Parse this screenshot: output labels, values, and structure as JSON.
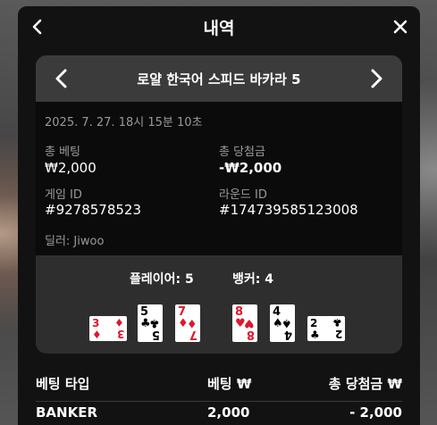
{
  "modal": {
    "title": "내역"
  },
  "game": {
    "title": "로얄 한국어 스피드 바카라 5"
  },
  "details": {
    "timestamp": "2025. 7. 27. 18시 15분 10초",
    "total_bet_label": "총 베팅",
    "total_bet_value": "₩2,000",
    "total_win_label": "총 당첨금",
    "total_win_value": "-₩2,000",
    "game_id_label": "게임 ID",
    "game_id_value": "#9278578523",
    "round_id_label": "라운드 ID",
    "round_id_value": "#174739585123008",
    "dealer": "딜러: Jiwoo"
  },
  "results": {
    "player_label": "플레이어: 5",
    "banker_label": "뱅커: 4",
    "player_cards": [
      {
        "rank": "3",
        "suit": "♦",
        "color": "#e0162b",
        "sideways": true
      },
      {
        "rank": "5",
        "suit": "♣",
        "color": "#000000",
        "sideways": false
      },
      {
        "rank": "7",
        "suit": "♦",
        "color": "#e0162b",
        "sideways": false
      }
    ],
    "banker_cards": [
      {
        "rank": "8",
        "suit": "♥",
        "color": "#e0162b",
        "sideways": false
      },
      {
        "rank": "4",
        "suit": "♠",
        "color": "#000000",
        "sideways": false
      },
      {
        "rank": "2",
        "suit": "♣",
        "color": "#000000",
        "sideways": true
      }
    ]
  },
  "table": {
    "headers": [
      "베팅 타입",
      "베팅 ₩",
      "총 당첨금 ₩"
    ],
    "rows": [
      {
        "bet_type": "BANKER",
        "bet": "2,000",
        "win": "- 2,000"
      }
    ]
  },
  "icons": {
    "back": "chevron-left-icon",
    "close": "close-icon",
    "prev": "chevron-left-icon",
    "next": "chevron-right-icon"
  }
}
